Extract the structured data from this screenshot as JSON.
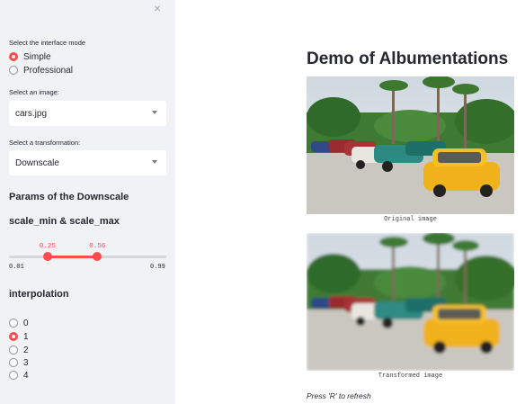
{
  "sidebar": {
    "close_symbol": "×",
    "mode": {
      "label": "Select the interface mode",
      "options": [
        {
          "label": "Simple",
          "selected": true
        },
        {
          "label": "Professional",
          "selected": false
        }
      ]
    },
    "image_select": {
      "label": "Select an image:",
      "value": "cars.jpg"
    },
    "transform_select": {
      "label": "Select a transformation:",
      "value": "Downscale"
    },
    "params_heading": "Params of the Downscale",
    "slider": {
      "label": "scale_min & scale_max",
      "min": "0.01",
      "max": "0.99",
      "low_value": "0.25",
      "high_value": "0.56",
      "low_num": 0.25,
      "high_num": 0.56,
      "range_min": 0.01,
      "range_max": 0.99
    },
    "interpolation": {
      "label": "interpolation",
      "options": [
        {
          "label": "0",
          "selected": false
        },
        {
          "label": "1",
          "selected": true
        },
        {
          "label": "2",
          "selected": false
        },
        {
          "label": "3",
          "selected": false
        },
        {
          "label": "4",
          "selected": false
        }
      ]
    }
  },
  "main": {
    "title": "Demo of Albumentations",
    "original_caption": "Original image",
    "transformed_caption": "Transformed image",
    "refresh_hint": "Press 'R' to refresh"
  },
  "colors": {
    "accent": "#ff4b4b",
    "sidebar_bg": "#f0f2f6",
    "text": "#262730"
  },
  "icons": {
    "close": "close-icon",
    "dropdown": "chevron-down-icon"
  }
}
